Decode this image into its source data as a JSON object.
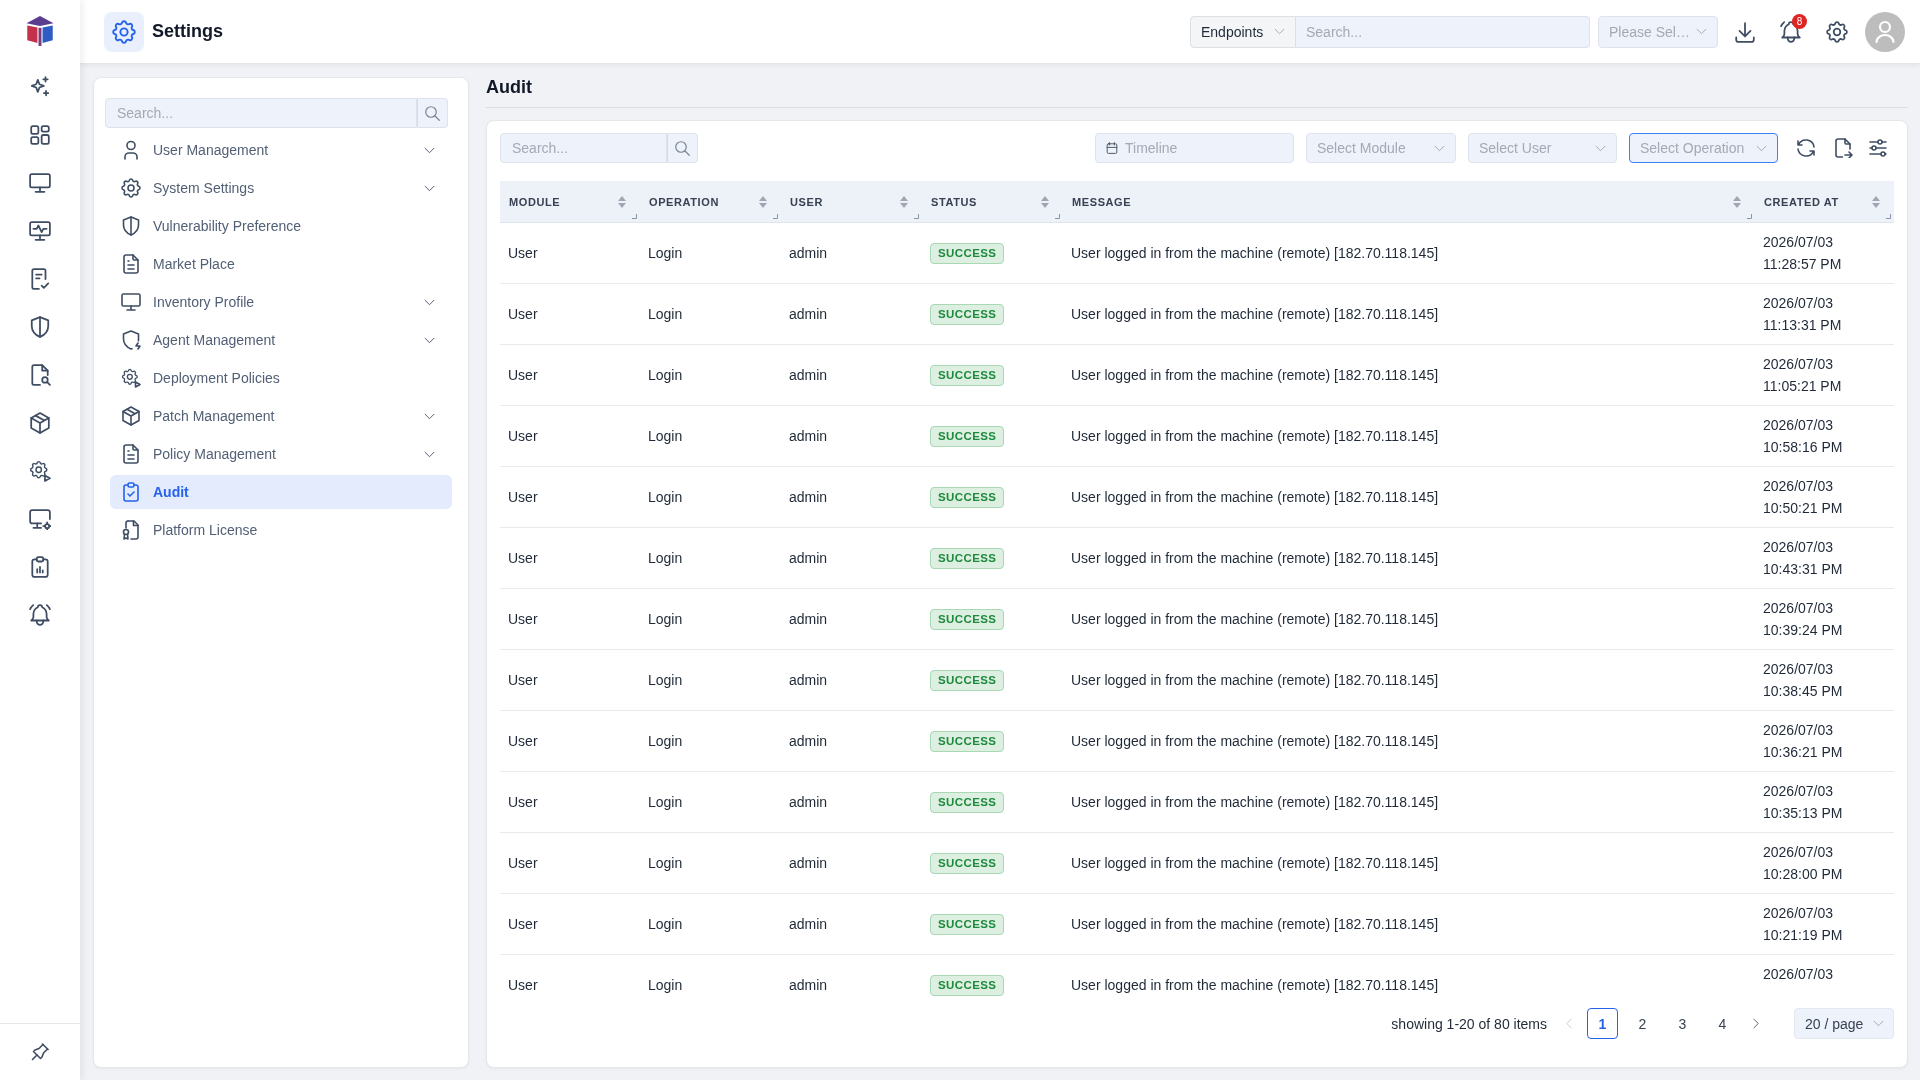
{
  "header": {
    "title": "Settings",
    "scope": {
      "label": "Endpoints"
    },
    "search": {
      "placeholder": "Search..."
    },
    "select": {
      "placeholder": "Please Sel…"
    },
    "notifications": {
      "count": "8"
    }
  },
  "sidebar": {
    "search": {
      "placeholder": "Search..."
    },
    "items": [
      {
        "label": "User Management",
        "kind": "submenu",
        "selected": false
      },
      {
        "label": "System Settings",
        "kind": "submenu",
        "selected": false
      },
      {
        "label": "Vulnerability Preference",
        "kind": "link",
        "selected": false
      },
      {
        "label": "Market Place",
        "kind": "link",
        "selected": false
      },
      {
        "label": "Inventory Profile",
        "kind": "submenu",
        "selected": false
      },
      {
        "label": "Agent Management",
        "kind": "submenu",
        "selected": false
      },
      {
        "label": "Deployment Policies",
        "kind": "link",
        "selected": false
      },
      {
        "label": "Patch Management",
        "kind": "submenu",
        "selected": false
      },
      {
        "label": "Policy Management",
        "kind": "submenu",
        "selected": false
      },
      {
        "label": "Audit",
        "kind": "link",
        "selected": true
      },
      {
        "label": "Platform License",
        "kind": "link",
        "selected": false
      }
    ]
  },
  "page": {
    "title": "Audit"
  },
  "toolbar": {
    "search": {
      "placeholder": "Search..."
    },
    "filters": [
      {
        "kind": "date",
        "placeholder": "Timeline",
        "focused": false
      },
      {
        "kind": "select",
        "placeholder": "Select Module",
        "focused": false
      },
      {
        "kind": "select",
        "placeholder": "Select User",
        "focused": false
      },
      {
        "kind": "select",
        "placeholder": "Select Operation",
        "focused": true
      }
    ]
  },
  "table": {
    "columns": [
      {
        "label": "MODULE",
        "sortable": true
      },
      {
        "label": "OPERATION",
        "sortable": true
      },
      {
        "label": "USER",
        "sortable": true
      },
      {
        "label": "STATUS",
        "sortable": true
      },
      {
        "label": "MESSAGE",
        "sortable": true
      },
      {
        "label": "CREATED AT",
        "sortable": true
      }
    ],
    "rows": [
      {
        "module": "User",
        "operation": "Login",
        "user": "admin",
        "status": {
          "label": "SUCCESS",
          "kind": "success"
        },
        "message": "User logged in from the machine (remote) [182.70.118.145]",
        "created_at": "2026/07/03 11:28:57 PM"
      },
      {
        "module": "User",
        "operation": "Login",
        "user": "admin",
        "status": {
          "label": "SUCCESS",
          "kind": "success"
        },
        "message": "User logged in from the machine (remote) [182.70.118.145]",
        "created_at": "2026/07/03 11:13:31 PM"
      },
      {
        "module": "User",
        "operation": "Login",
        "user": "admin",
        "status": {
          "label": "SUCCESS",
          "kind": "success"
        },
        "message": "User logged in from the machine (remote) [182.70.118.145]",
        "created_at": "2026/07/03 11:05:21 PM"
      },
      {
        "module": "User",
        "operation": "Login",
        "user": "admin",
        "status": {
          "label": "SUCCESS",
          "kind": "success"
        },
        "message": "User logged in from the machine (remote) [182.70.118.145]",
        "created_at": "2026/07/03 10:58:16 PM"
      },
      {
        "module": "User",
        "operation": "Login",
        "user": "admin",
        "status": {
          "label": "SUCCESS",
          "kind": "success"
        },
        "message": "User logged in from the machine (remote) [182.70.118.145]",
        "created_at": "2026/07/03 10:50:21 PM"
      },
      {
        "module": "User",
        "operation": "Login",
        "user": "admin",
        "status": {
          "label": "SUCCESS",
          "kind": "success"
        },
        "message": "User logged in from the machine (remote) [182.70.118.145]",
        "created_at": "2026/07/03 10:43:31 PM"
      },
      {
        "module": "User",
        "operation": "Login",
        "user": "admin",
        "status": {
          "label": "SUCCESS",
          "kind": "success"
        },
        "message": "User logged in from the machine (remote) [182.70.118.145]",
        "created_at": "2026/07/03 10:39:24 PM"
      },
      {
        "module": "User",
        "operation": "Login",
        "user": "admin",
        "status": {
          "label": "SUCCESS",
          "kind": "success"
        },
        "message": "User logged in from the machine (remote) [182.70.118.145]",
        "created_at": "2026/07/03 10:38:45 PM"
      },
      {
        "module": "User",
        "operation": "Login",
        "user": "admin",
        "status": {
          "label": "SUCCESS",
          "kind": "success"
        },
        "message": "User logged in from the machine (remote) [182.70.118.145]",
        "created_at": "2026/07/03 10:36:21 PM"
      },
      {
        "module": "User",
        "operation": "Login",
        "user": "admin",
        "status": {
          "label": "SUCCESS",
          "kind": "success"
        },
        "message": "User logged in from the machine (remote) [182.70.118.145]",
        "created_at": "2026/07/03 10:35:13 PM"
      },
      {
        "module": "User",
        "operation": "Login",
        "user": "admin",
        "status": {
          "label": "SUCCESS",
          "kind": "success"
        },
        "message": "User logged in from the machine (remote) [182.70.118.145]",
        "created_at": "2026/07/03 10:28:00 PM"
      },
      {
        "module": "User",
        "operation": "Login",
        "user": "admin",
        "status": {
          "label": "SUCCESS",
          "kind": "success"
        },
        "message": "User logged in from the machine (remote) [182.70.118.145]",
        "created_at": "2026/07/03 10:21:19 PM"
      },
      {
        "module": "User",
        "operation": "Login",
        "user": "admin",
        "status": {
          "label": "SUCCESS",
          "kind": "success"
        },
        "message": "User logged in from the machine (remote) [182.70.118.145]",
        "created_at": "2026/07/03"
      }
    ]
  },
  "pagination": {
    "summary": "showing 1-20 of 80 items",
    "prev": {
      "disabled": true
    },
    "pages": [
      {
        "label": "1",
        "selected": true
      },
      {
        "label": "2",
        "selected": false
      },
      {
        "label": "3",
        "selected": false
      },
      {
        "label": "4",
        "selected": false
      }
    ],
    "next": {
      "disabled": false
    },
    "page_size": "20 / page"
  }
}
